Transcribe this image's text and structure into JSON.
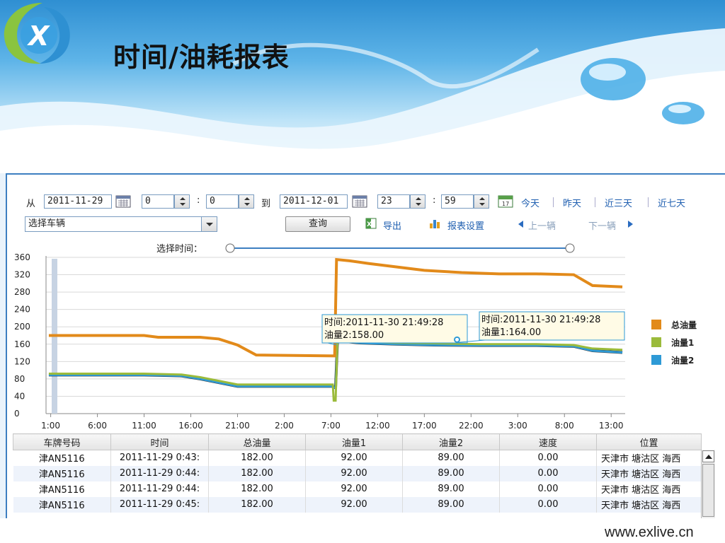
{
  "page_title": "时间/油耗报表",
  "query_bar": {
    "from_label": "从",
    "start_date": "2011-11-29",
    "start_hour": "0",
    "start_minute": "0",
    "colon": ":",
    "to_label": "到",
    "end_date": "2011-12-01",
    "end_hour": "23",
    "end_minute": "59",
    "quick_ranges": [
      "今天",
      "昨天",
      "近三天",
      "近七天"
    ],
    "vehicle_placeholder": "选择车辆",
    "query_button": "查询",
    "export_label": "导出",
    "report_settings_label": "报表设置",
    "prev_vehicle": "上一辆",
    "next_vehicle": "下一辆",
    "time_slider_label": "选择时间："
  },
  "colors": {
    "total_fuel": "#e28a1a",
    "fuel1": "#9bbb3b",
    "fuel2": "#2e9ad6",
    "link": "#1f5fb0",
    "panel_border": "#3d7fc1"
  },
  "chart_data": {
    "type": "line",
    "ylim": [
      0,
      360
    ],
    "yticks": [
      0,
      40,
      80,
      120,
      160,
      200,
      240,
      280,
      320,
      360
    ],
    "xtick_labels": [
      "1:00",
      "6:00",
      "11:00",
      "16:00",
      "21:00",
      "2:00",
      "7:00",
      "12:00",
      "17:00",
      "22:00",
      "3:00",
      "8:00",
      "13:00"
    ],
    "xtick_hours": [
      1,
      6,
      11,
      16,
      21,
      26,
      31,
      36,
      41,
      46,
      51,
      56,
      61
    ],
    "xlim_hours": [
      0.5,
      62.5
    ],
    "grid": true,
    "legend_position": "right",
    "series": [
      {
        "name": "总油量",
        "color": "#e28a1a",
        "x": [
          0.8,
          11,
          12.5,
          17,
          19,
          21,
          23,
          31.3,
          31.4,
          31.6,
          33,
          35,
          38,
          41,
          45,
          49,
          53,
          57,
          59,
          62.2
        ],
        "y": [
          180,
          180,
          176,
          176,
          172,
          158,
          135,
          133,
          133,
          355,
          352,
          346,
          338,
          330,
          325,
          322,
          322,
          320,
          295,
          292
        ]
      },
      {
        "name": "油量1",
        "color": "#9bbb3b",
        "x": [
          0.8,
          11,
          15,
          17,
          21,
          25,
          31.2,
          31.3,
          31.5,
          31.7,
          34,
          38,
          42,
          47,
          53,
          57,
          59,
          62.2
        ],
        "y": [
          92,
          92,
          90,
          84,
          67,
          67,
          67,
          30,
          30,
          172,
          166,
          163,
          162,
          160,
          160,
          158,
          150,
          147
        ]
      },
      {
        "name": "油量2",
        "color": "#2e9ad6",
        "x": [
          0.8,
          11,
          15,
          17,
          21,
          25,
          31.2,
          31.3,
          31.5,
          31.7,
          34,
          38,
          42,
          47,
          53,
          57,
          59,
          62.2
        ],
        "y": [
          89,
          89,
          87,
          80,
          63,
          63,
          63,
          60,
          60,
          168,
          163,
          160,
          158,
          157,
          157,
          155,
          145,
          141
        ]
      }
    ],
    "tooltips": [
      {
        "time": "时间:2011-11-30 21:49:28",
        "value": "油量2:158.00"
      },
      {
        "time": "时间:2011-11-30 21:49:28",
        "value": "油量1:164.00"
      }
    ]
  },
  "table": {
    "headers": [
      "车牌号码",
      "时间",
      "总油量",
      "油量1",
      "油量2",
      "速度",
      "位置"
    ],
    "rows": [
      [
        "津AN5116",
        "2011-11-29 0:43:",
        "182.00",
        "92.00",
        "89.00",
        "0.00",
        "天津市 塘沽区 海西"
      ],
      [
        "津AN5116",
        "2011-11-29 0:44:",
        "182.00",
        "92.00",
        "89.00",
        "0.00",
        "天津市 塘沽区 海西"
      ],
      [
        "津AN5116",
        "2011-11-29 0:44:",
        "182.00",
        "92.00",
        "89.00",
        "0.00",
        "天津市 塘沽区 海西"
      ],
      [
        "津AN5116",
        "2011-11-29 0:45:",
        "182.00",
        "92.00",
        "89.00",
        "0.00",
        "天津市 塘沽区 海西"
      ]
    ]
  },
  "footer": {
    "url": "www.exlive.cn"
  },
  "icons": [
    "logo-x",
    "calendar-icon",
    "today-calendar-icon",
    "export-excel-icon",
    "report-chart-icon",
    "prev-arrow-icon",
    "next-arrow-icon"
  ]
}
